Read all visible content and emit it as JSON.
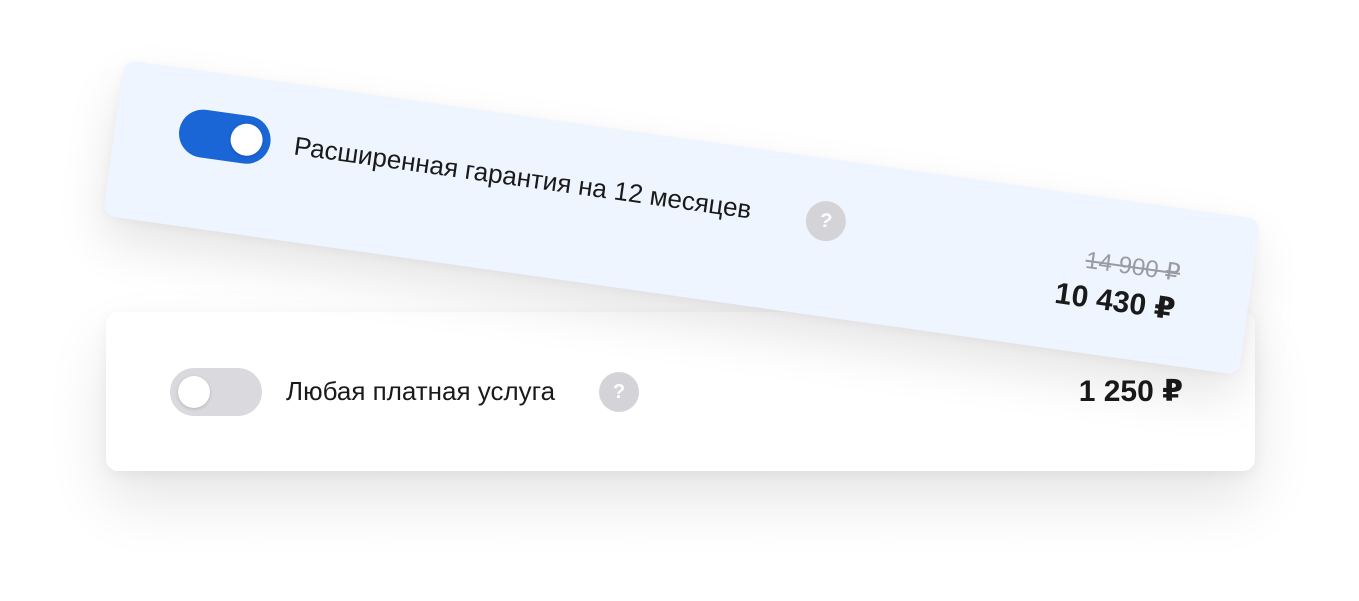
{
  "colors": {
    "accent": "#1a66d6",
    "highlight_bg": "#eef5ff",
    "toggle_off": "#d9d9de",
    "help_icon": "#d4d4d8"
  },
  "options": [
    {
      "label": "Расширенная гарантия на 12 месяцев",
      "enabled": true,
      "help_icon": "question-icon",
      "help_glyph": "?",
      "old_price": "14 900 ₽",
      "price": "10 430 ₽"
    },
    {
      "label": "Любая платная услуга",
      "enabled": false,
      "help_icon": "question-icon",
      "help_glyph": "?",
      "price": "1 250 ₽"
    }
  ]
}
